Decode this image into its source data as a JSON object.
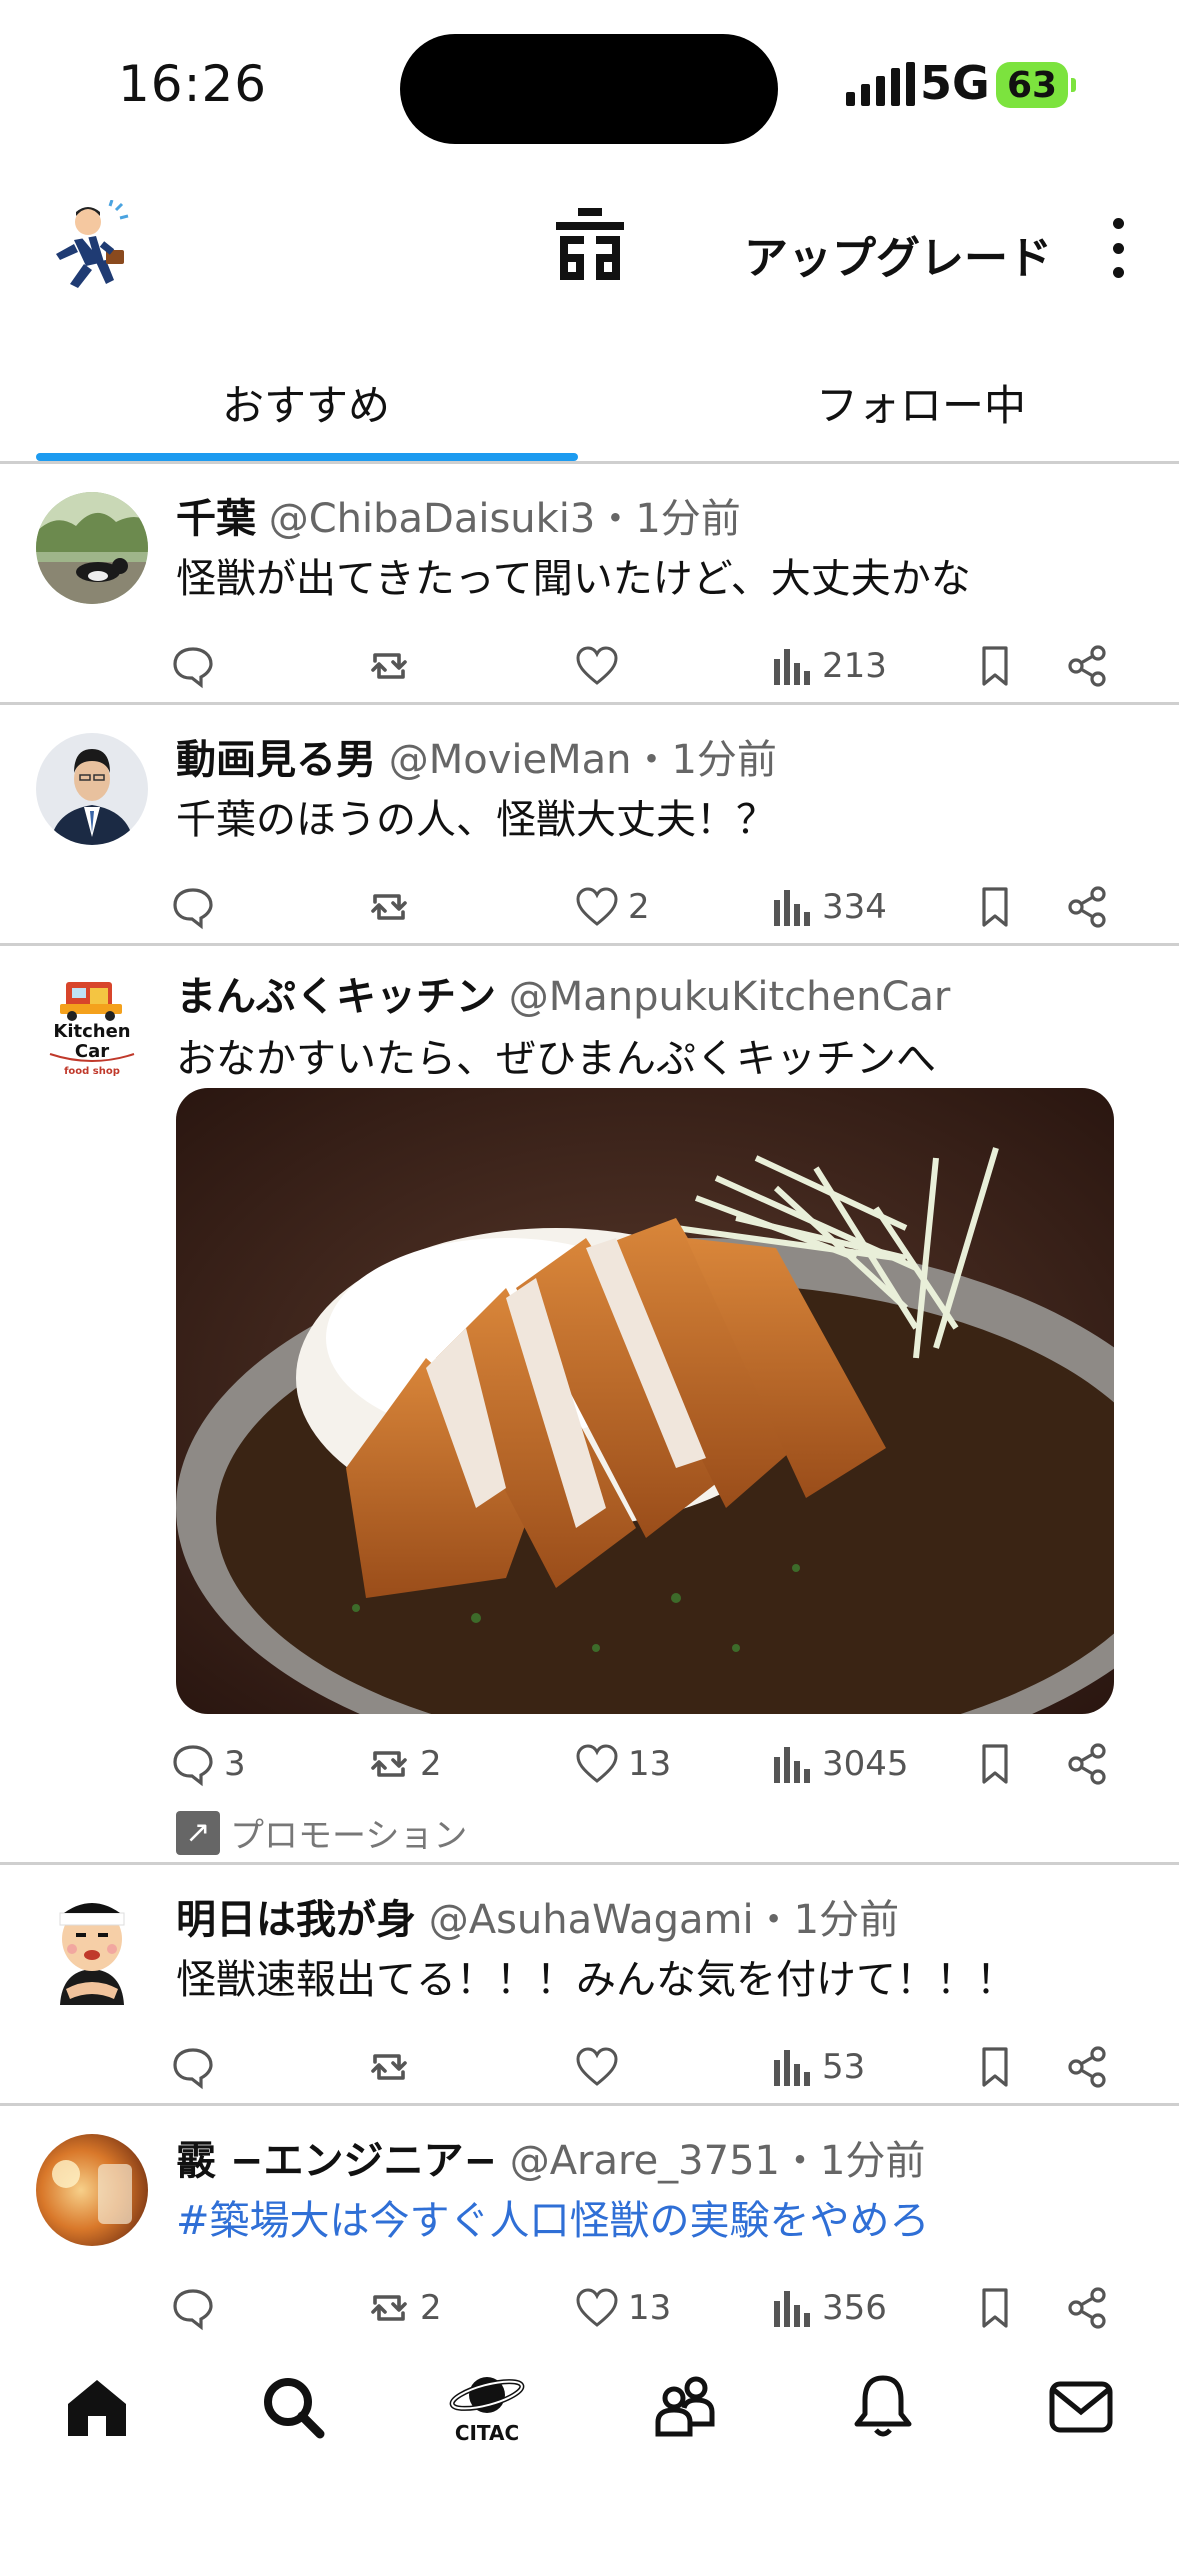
{
  "status_bar": {
    "time": "16:26",
    "network": "5G",
    "battery": "63"
  },
  "header": {
    "upgrade_label": "アップグレード"
  },
  "tabs": [
    {
      "label": "おすすめ"
    },
    {
      "label": "フォロー中"
    }
  ],
  "posts": [
    {
      "name": "千葉",
      "handle": "@ChibaDaisuki3",
      "time": "・1分前",
      "text": "怪獣が出てきたって聞いたけど、大丈夫かな",
      "replies": "",
      "retweets": "",
      "likes": "",
      "views": "213"
    },
    {
      "name": "動画見る男",
      "handle": "@MovieMan",
      "time": "・1分前",
      "text": "千葉のほうの人、怪獣大丈夫！？",
      "replies": "",
      "retweets": "",
      "likes": "2",
      "views": "334"
    },
    {
      "name": "まんぷくキッチン",
      "handle": "@ManpukuKitchenCar",
      "time": "",
      "text": "おなかすいたら、ぜひまんぷくキッチンへ",
      "replies": "3",
      "retweets": "2",
      "likes": "13",
      "views": "3045",
      "promo": "プロモーション",
      "logo_text": "Kitchen Car",
      "logo_sub": "food shop"
    },
    {
      "name": "明日は我が身",
      "handle": "@AsuhaWagami",
      "time": "・1分前",
      "text": "怪獣速報出てる！！！みんな気を付けて！！！",
      "replies": "",
      "retweets": "",
      "likes": "",
      "views": "53"
    },
    {
      "name": "霰 −エンジニア−",
      "handle": "@Arare_3751",
      "time": "・1分前",
      "text": "#築場大は今すぐ人口怪獣の実験をやめろ",
      "replies": "",
      "retweets": "2",
      "likes": "13",
      "views": "356"
    }
  ],
  "bottom_nav": {
    "space_label": "CITAC"
  },
  "colors": {
    "accent": "#1d9bf0",
    "link": "#2f6fd6",
    "battery": "#7CE33E"
  }
}
